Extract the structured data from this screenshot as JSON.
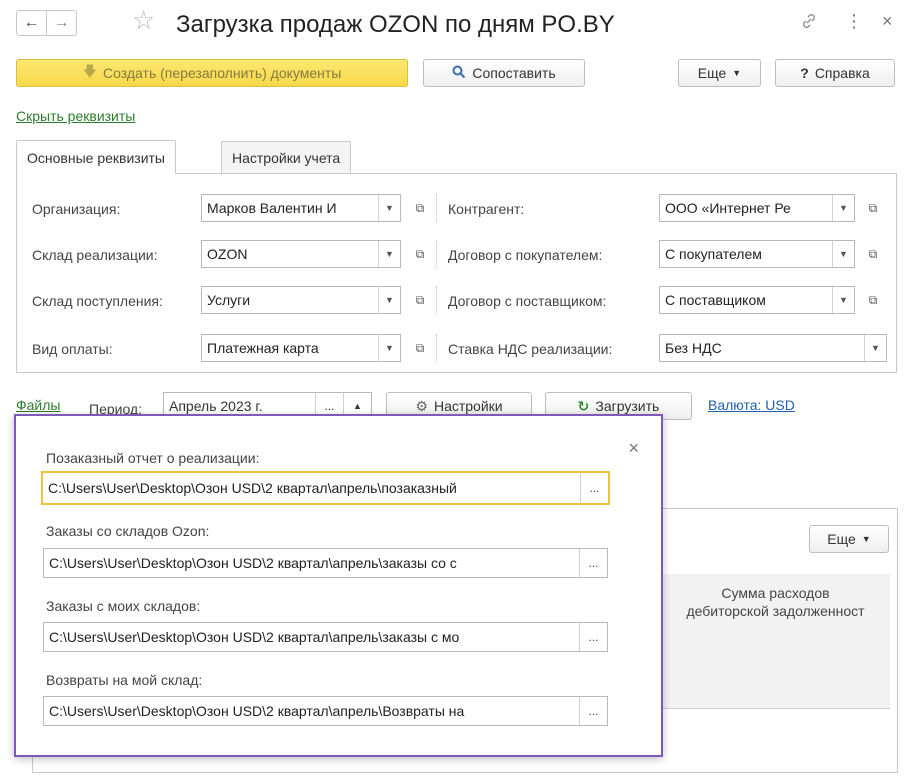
{
  "window": {
    "title": "Загрузка продаж OZON по дням PO.BY",
    "back_glyph": "←",
    "forward_glyph": "→",
    "star_glyph": "☆",
    "link_glyph": "🔗",
    "menu_glyph": "⋮",
    "close_glyph": "×"
  },
  "toolbar": {
    "create_label": "Создать (перезаполнить) документы",
    "compare_label": "Сопоставить",
    "more_label": "Еще",
    "help_label": "Справка",
    "help_glyph": "?"
  },
  "hide_details_link": "Скрыть реквизиты",
  "tabs": [
    {
      "label": "Основные реквизиты"
    },
    {
      "label": "Настройки учета"
    }
  ],
  "left_fields": [
    {
      "label": "Организация:",
      "value": "Марков Валентин И"
    },
    {
      "label": "Склад реализации:",
      "value": "OZON"
    },
    {
      "label": "Склад поступления:",
      "value": "Услуги"
    },
    {
      "label": "Вид оплаты:",
      "value": "Платежная карта"
    }
  ],
  "right_fields": [
    {
      "label": "Контрагент:",
      "value": "ООО «Интернет Ре"
    },
    {
      "label": "Договор с покупателем:",
      "value": "С покупателем"
    },
    {
      "label": "Договор с поставщиком:",
      "value": "С поставщиком"
    },
    {
      "label": "Ставка НДС реализации:",
      "value": "Без НДС"
    }
  ],
  "period_row": {
    "files_link": "Файлы",
    "period_label": "Период:",
    "period_value": "Апрель 2023 г.",
    "settings_label": "Настройки",
    "load_label": "Загрузить",
    "currency_link": "Валюта: USD"
  },
  "table": {
    "more_label": "Еще",
    "column_header_line1": "Сумма расходов",
    "column_header_line2": "дебиторской задолженност"
  },
  "popup": {
    "close_glyph": "×",
    "fields": [
      {
        "label": "Позаказный отчет о реализации:",
        "value": "C:\\Users\\User\\Desktop\\Озон USD\\2 квартал\\апрель\\позаказный"
      },
      {
        "label": "Заказы со складов Ozon:",
        "value": "C:\\Users\\User\\Desktop\\Озон USD\\2 квартал\\апрель\\заказы со с"
      },
      {
        "label": "Заказы с моих складов:",
        "value": "C:\\Users\\User\\Desktop\\Озон USD\\2 квартал\\апрель\\заказы с мо"
      },
      {
        "label": "Возвраты на мой склад:",
        "value": "C:\\Users\\User\\Desktop\\Озон USD\\2 квартал\\апрель\\Возвраты на"
      }
    ],
    "browse_glyph": "..."
  },
  "colors": {
    "accent_yellow": "#f6d94b",
    "popup_border": "#7e5ab8",
    "focus_border": "#f0c23a",
    "link_green": "#2d7d2d",
    "link_blue": "#1f5fb0"
  }
}
